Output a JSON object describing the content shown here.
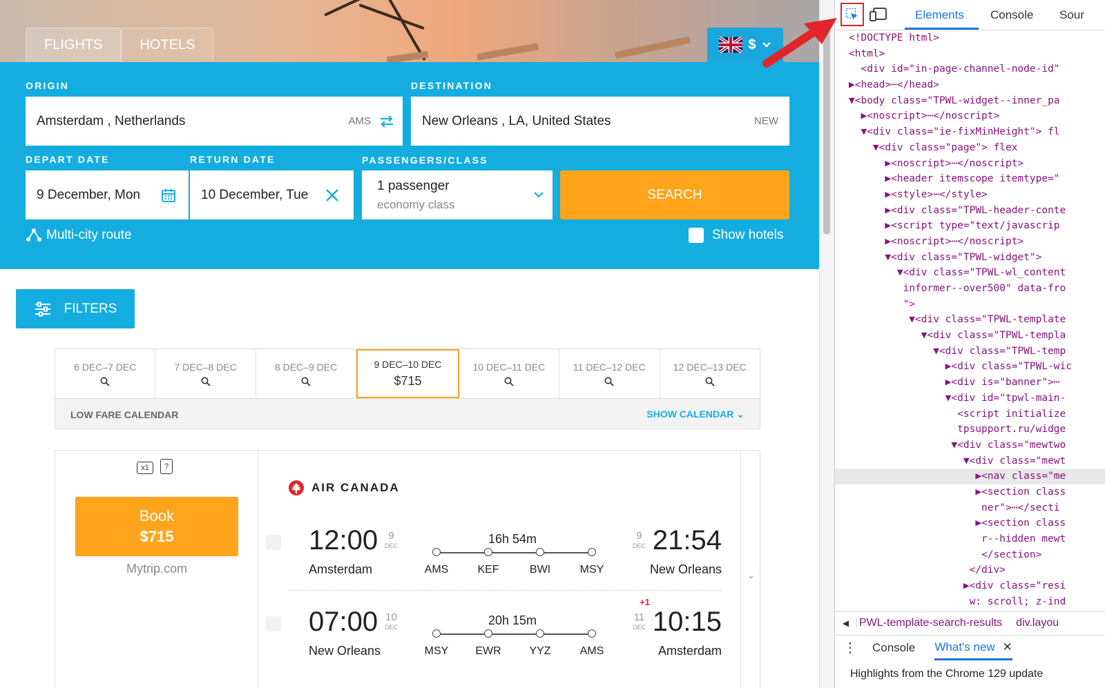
{
  "hero": {
    "tabs": [
      "FLIGHTS",
      "HOTELS"
    ],
    "currency_symbol": "$"
  },
  "search_form": {
    "origin_label": "ORIGIN",
    "origin_value": "Amsterdam , Netherlands",
    "origin_code": "AMS",
    "destination_label": "DESTINATION",
    "destination_value": "New Orleans , LA, United States",
    "destination_code": "NEW",
    "depart_label": "DEPART DATE",
    "depart_value": "9 December, Mon",
    "return_label": "RETURN DATE",
    "return_value": "10 December, Tue",
    "passengers_label": "PASSENGERS/CLASS",
    "passengers_value": "1 passenger",
    "class_value": "economy class",
    "search_button": "SEARCH",
    "multi_city": "Multi-city route",
    "show_hotels": "Show hotels"
  },
  "filters_button": "FILTERS",
  "date_strip": {
    "cells": [
      {
        "range": "6 DEC–7 DEC",
        "price": ""
      },
      {
        "range": "7 DEC–8 DEC",
        "price": ""
      },
      {
        "range": "8 DEC–9 DEC",
        "price": ""
      },
      {
        "range": "9 DEC–10 DEC",
        "price": "$715"
      },
      {
        "range": "10 DEC–11 DEC",
        "price": ""
      },
      {
        "range": "11 DEC–12 DEC",
        "price": ""
      },
      {
        "range": "12 DEC–13 DEC",
        "price": ""
      }
    ],
    "selected_index": 3,
    "low_fare_label": "LOW FARE CALENDAR",
    "show_calendar": "SHOW CALENDAR"
  },
  "result": {
    "baggage_badge": "x1",
    "carry_on_badge": "?",
    "book_label": "Book",
    "book_price": "$715",
    "agency": "Mytrip.com",
    "airline": "AIR CANADA",
    "segments": [
      {
        "dep_time": "12:00",
        "dep_day": "9",
        "dep_month": "DEC",
        "dep_city": "Amsterdam",
        "arr_time": "21:54",
        "arr_day": "9",
        "arr_month": "DEC",
        "arr_city": "New Orleans",
        "duration": "16h 54m",
        "stops": [
          "AMS",
          "KEF",
          "BWI",
          "MSY"
        ],
        "plus_day": ""
      },
      {
        "dep_time": "07:00",
        "dep_day": "10",
        "dep_month": "DEC",
        "dep_city": "New Orleans",
        "arr_time": "10:15",
        "arr_day": "11",
        "arr_month": "DEC",
        "arr_city": "Amsterdam",
        "duration": "20h 15m",
        "stops": [
          "MSY",
          "EWR",
          "YYZ",
          "AMS"
        ],
        "plus_day": "+1"
      }
    ]
  },
  "devtools": {
    "tabs": [
      "Elements",
      "Console",
      "Sour"
    ],
    "active_tab": "Elements",
    "tree": [
      "<!DOCTYPE html>",
      "<html>",
      "  <div id=\"in-page-channel-node-id\"",
      "▶<head>⋯</head>",
      "▼<body class=\"TPWL-widget--inner_pa",
      "  ▶<noscript>⋯</noscript>",
      "  ▼<div class=\"ie-fixMinHeight\"> fl",
      "    ▼<div class=\"page\"> flex",
      "      ▶<noscript>⋯</noscript>",
      "      ▶<header itemscope itemtype=\"",
      "      ▶<style>⋯</style>",
      "      ▶<div class=\"TPWL-header-conte",
      "      ▶<script type=\"text/javascrip",
      "      ▶<noscript>⋯</noscript>",
      "      ▼<div class=\"TPWL-widget\">",
      "        ▼<div class=\"TPWL-wl_content",
      "         informer--over500\" data-fro",
      "         \">",
      "          ▼<div class=\"TPWL-template",
      "            ▼<div class=\"TPWL-templa",
      "              ▼<div class=\"TPWL-temp",
      "                ▶<div class=\"TPWL-wic",
      "                ▶<div is=\"banner\">⋯",
      "                ▼<div id=\"tpwl-main-",
      "                  <script initialize",
      "                  tpsupport.ru/widge",
      "                 ▼<div class=\"mewtwo",
      "                   ▼<div class=\"mewt",
      "                     ▶<nav class=\"me",
      "                     ▶<section class",
      "                      ner\">⋯</secti",
      "                     ▶<section class",
      "                      r--hidden mewt",
      "                      </section>",
      "                    </div>",
      "                   ▶<div class=\"resi",
      "                    w: scroll; z-ind"
    ],
    "highlight_index": 28,
    "breadcrumb": [
      "PWL-template-search-results",
      "div.layou"
    ],
    "drawer_tabs": [
      "Console",
      "What's new"
    ],
    "drawer_active": "What's new",
    "drawer_text": "Highlights from the Chrome 129 update"
  }
}
